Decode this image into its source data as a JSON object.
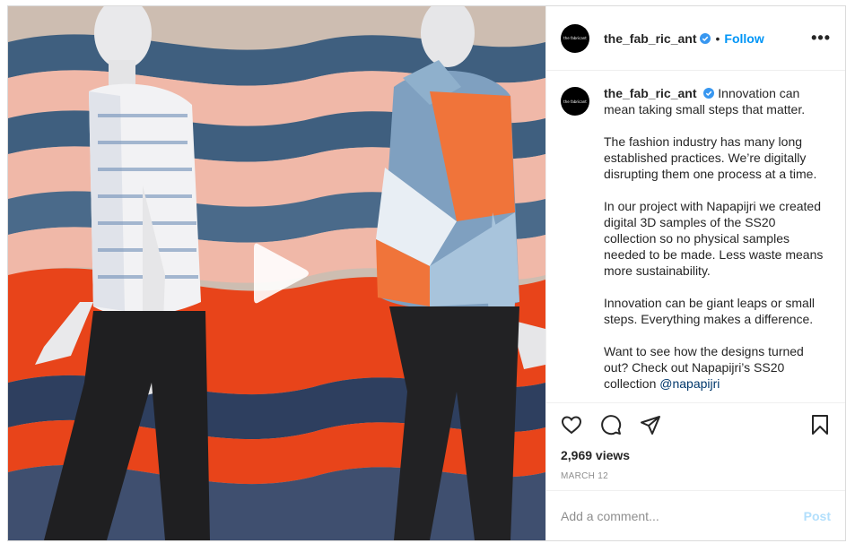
{
  "media": {
    "type": "video",
    "description_icon": "play-icon"
  },
  "header": {
    "avatar_text": "the fabricant",
    "username": "the_fab_ric_ant",
    "separator": "•",
    "follow_label": "Follow",
    "more_label": "•••"
  },
  "caption": {
    "username": "the_fab_ric_ant",
    "paragraphs": [
      "Innovation can mean taking small steps that matter.",
      "The fashion industry has many long established practices. We’re digitally disrupting them one process at a time.",
      "In our project with Napapijri we created digital 3D samples of the SS20 collection so no physical samples needed to be made. Less waste means more sustainability.",
      "Innovation can be giant leaps or small steps. Everything makes a difference.",
      "Want to see how the designs turned out? Check out Napapijri’s SS20 collection"
    ],
    "mention": "@napapijri"
  },
  "stats": {
    "views": "2,969 views",
    "date": "MARCH 12"
  },
  "comment": {
    "placeholder": "Add a comment...",
    "post_label": "Post"
  },
  "colors": {
    "accent": "#0095f6",
    "post_disabled": "#b2dffc",
    "wave_blue": "#3f5f7f",
    "wave_pink": "#f0b8a8",
    "wave_orange": "#e8441a",
    "wave_navy": "#2e3f5f"
  }
}
